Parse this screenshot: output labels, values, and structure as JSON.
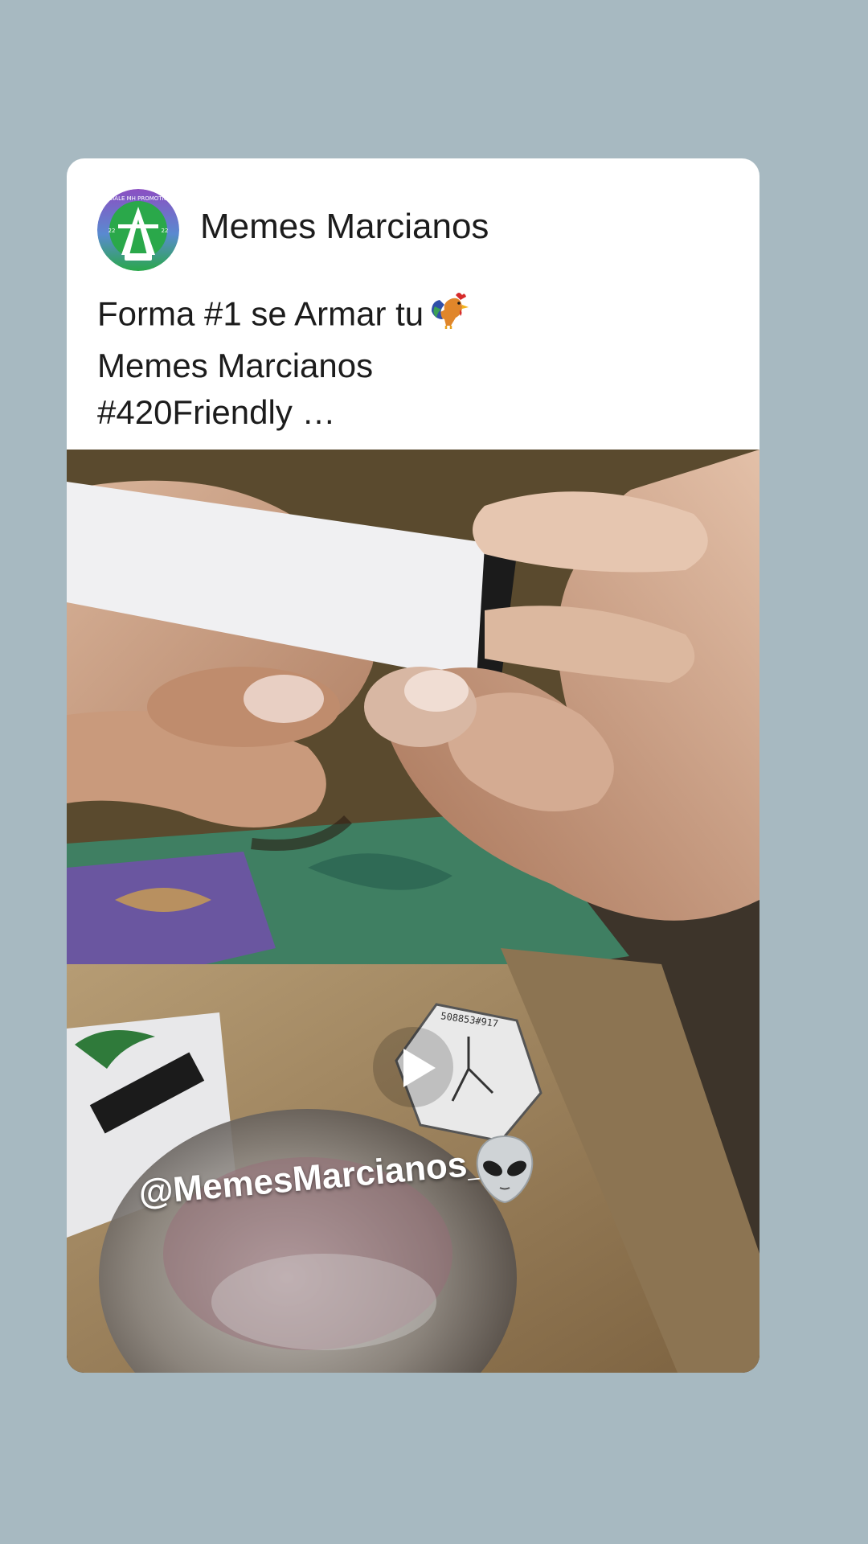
{
  "post": {
    "author": "Memes Marcianos",
    "caption_lines": [
      "Forma #1 se Armar tu",
      "Memes Marcianos",
      "#420Friendly …"
    ],
    "caption_emoji": "rooster-icon",
    "avatar_text": "DIALE MH PROMOTIO",
    "avatar_side_left": "22",
    "avatar_side_right": "22",
    "media": {
      "type": "video",
      "play_icon": "play-icon",
      "watermark": "@MemesMarcianos_",
      "watermark_emoji": "alien-icon",
      "box_label": "508853#917"
    }
  },
  "colors": {
    "background": "#a7b9c1",
    "card": "#ffffff",
    "text": "#1c1c1c",
    "avatar_ring": "#2aa84a",
    "avatar_purple": "#7a4fb4"
  }
}
